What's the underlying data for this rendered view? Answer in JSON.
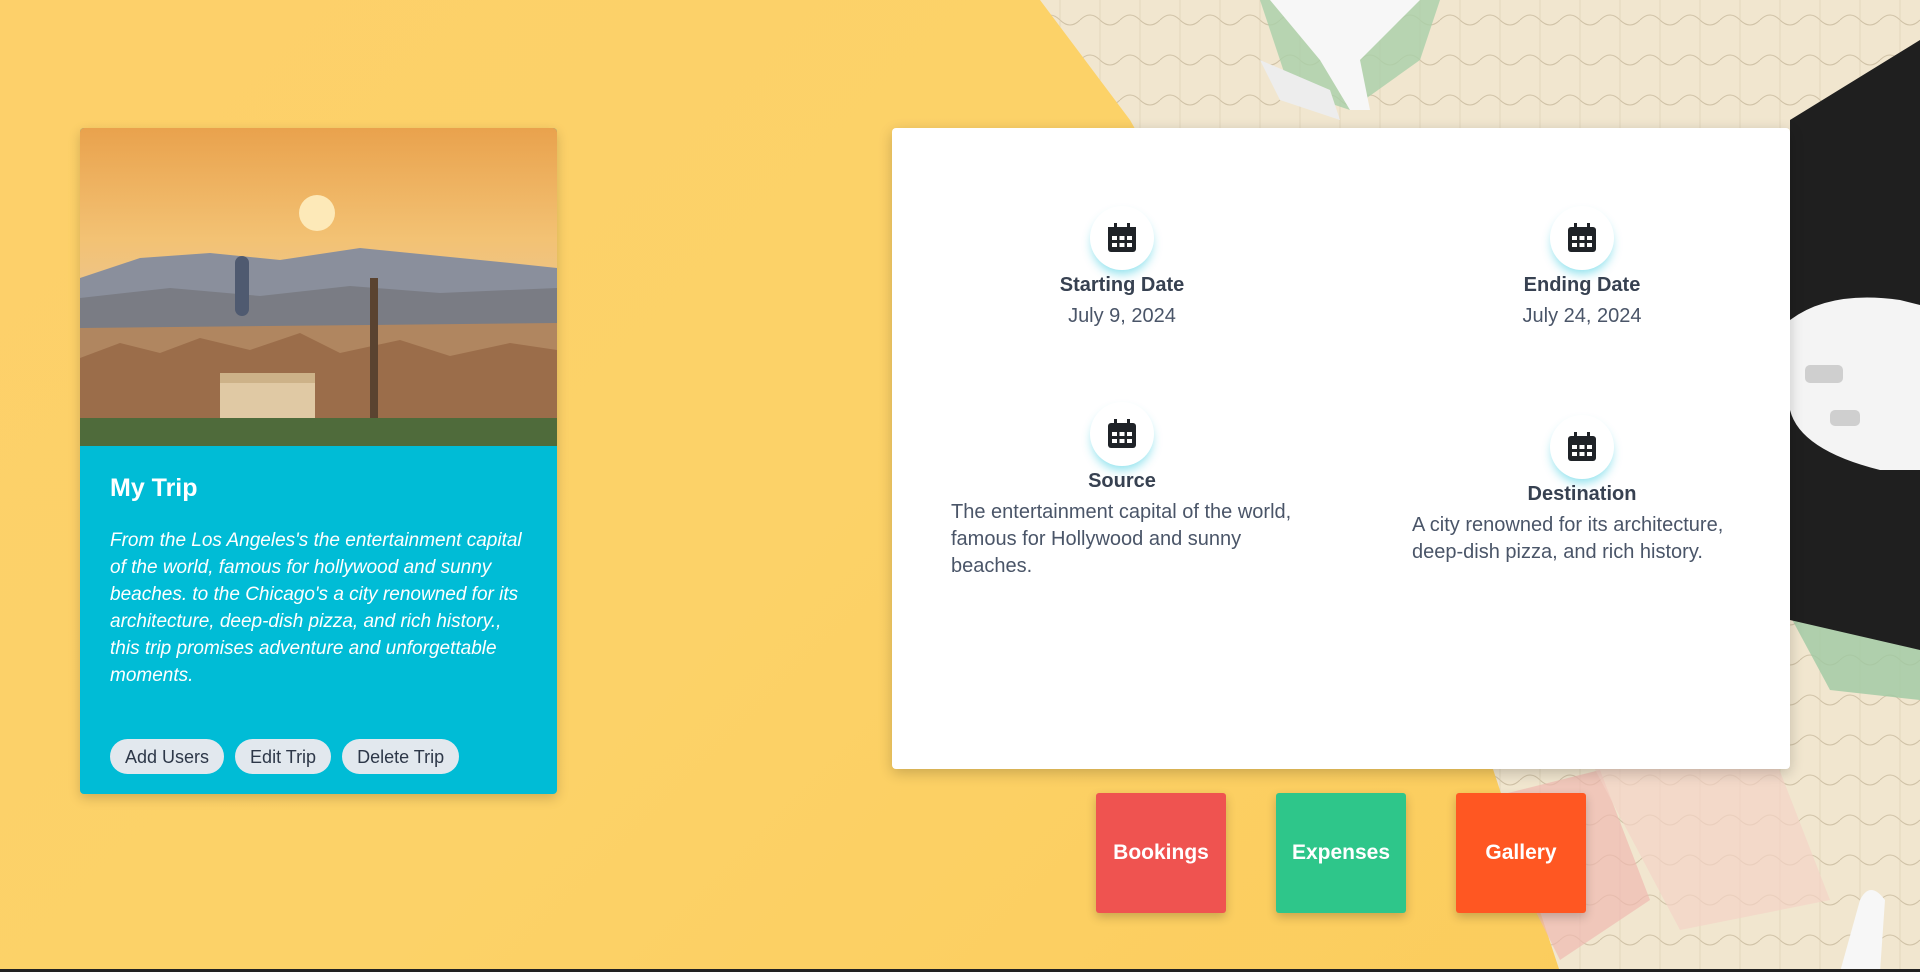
{
  "trip": {
    "title": "My Trip",
    "description": "From the Los Angeles's the entertainment capital of the world, famous for hollywood and sunny beaches. to the Chicago's a city renowned for its architecture, deep-dish pizza, and rich history., this trip promises adventure and unforgettable moments.",
    "buttons": {
      "add_users": "Add Users",
      "edit_trip": "Edit Trip",
      "delete_trip": "Delete Trip"
    }
  },
  "details": {
    "starting_date": {
      "label": "Starting Date",
      "value": "July 9, 2024",
      "icon": "calendar-icon"
    },
    "ending_date": {
      "label": "Ending Date",
      "value": "July 24, 2024",
      "icon": "calendar-icon"
    },
    "source": {
      "label": "Source",
      "value": "The entertainment capital of the world, famous for Hollywood and sunny beaches.",
      "icon": "calendar-icon"
    },
    "destination": {
      "label": "Destination",
      "value": "A city renowned for its architecture, deep-dish pizza, and rich history.",
      "icon": "calendar-icon"
    }
  },
  "nav": {
    "bookings": {
      "label": "Bookings",
      "color": "#ef5350"
    },
    "expenses": {
      "label": "Expenses",
      "color": "#2ec68a"
    },
    "gallery": {
      "label": "Gallery",
      "color": "#ff5722"
    }
  },
  "colors": {
    "background": "#fcd268",
    "card": "#00bcd6",
    "panel": "#ffffff"
  }
}
